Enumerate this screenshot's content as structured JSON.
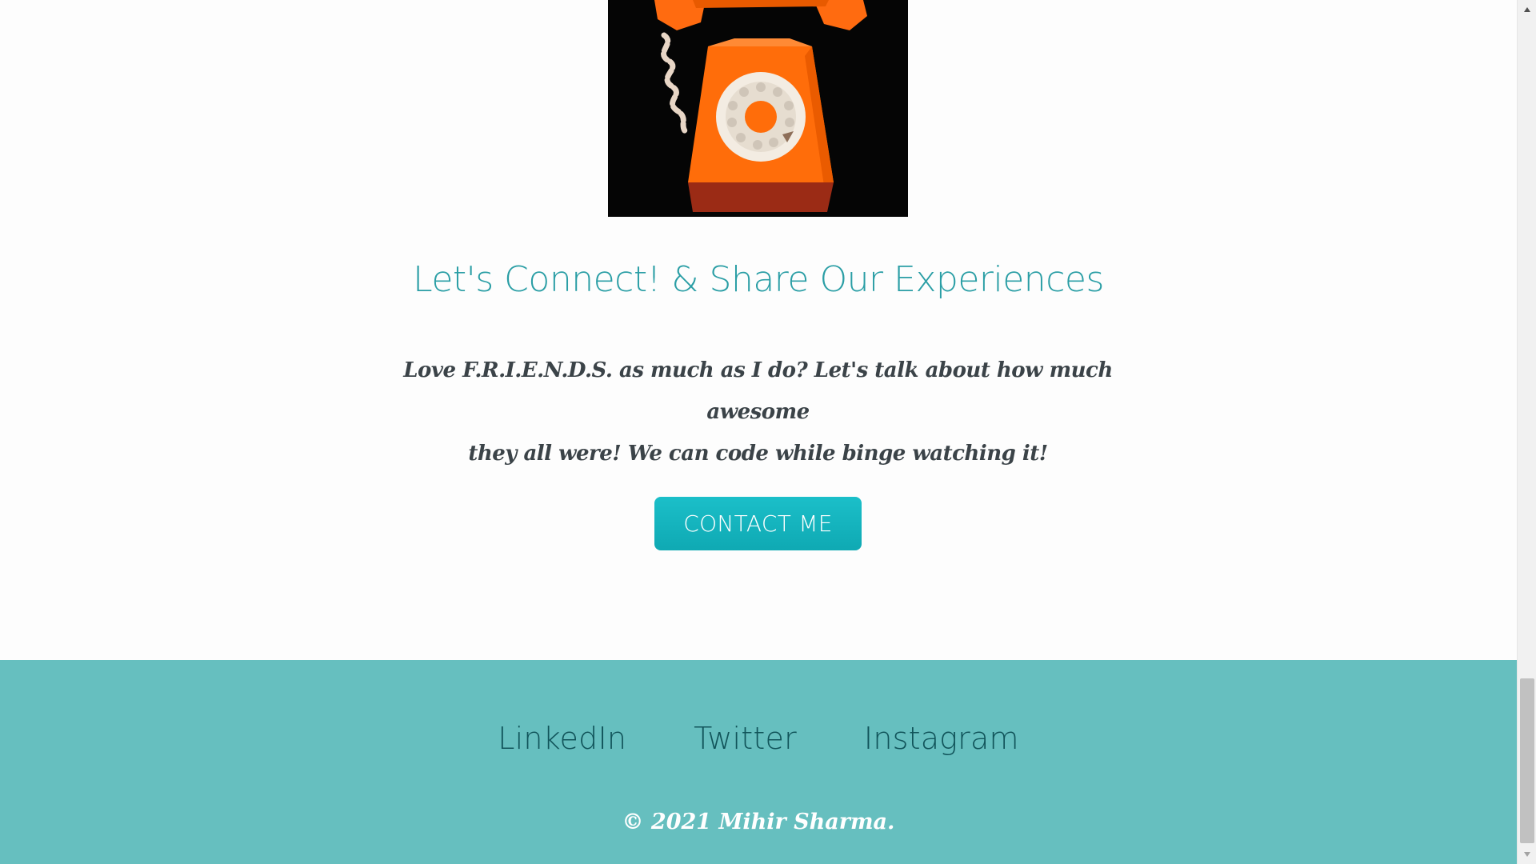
{
  "contact_section": {
    "heading": "Let's Connect! & Share Our Experiences",
    "text_line_1": "Love F.R.I.E.N.D.S. as much as I do?   Let's talk about how much awesome",
    "text_line_2": "they all were!  We can code while binge watching it!",
    "button_label": "CONTACT ME"
  },
  "footer": {
    "links": [
      "LinkedIn",
      "Twitter",
      "Instagram"
    ],
    "copyright": "© 2021 Mihir Sharma."
  },
  "icons": {
    "image": "rotary-phone-image",
    "scroll_up": "scroll-up-arrow-icon",
    "scroll_down": "scroll-down-arrow-icon"
  },
  "colors": {
    "heading": "#2a9ea5",
    "button": "#12b5bf",
    "footer_bg": "#66bfbf",
    "footer_link": "#11545a",
    "paragraph": "#3b4348"
  }
}
